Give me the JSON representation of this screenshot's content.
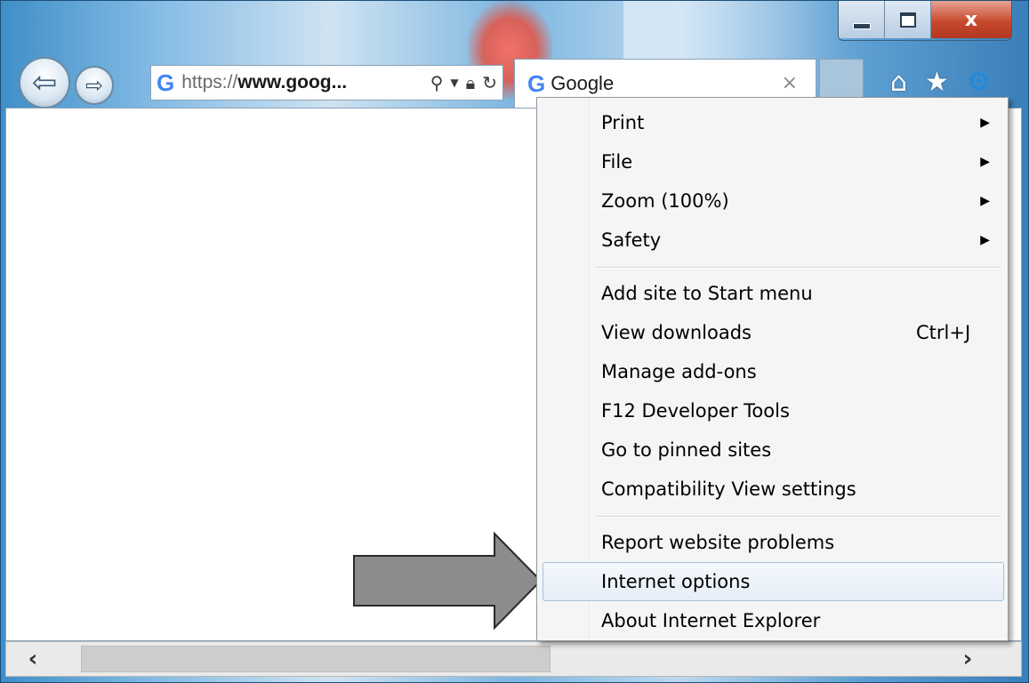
{
  "browser": {
    "address_bar": {
      "url_proto": "https://",
      "url_domain": "www.goog...",
      "icons": [
        "search-icon",
        "dropdown-icon",
        "lock-icon",
        "refresh-icon"
      ]
    },
    "tab": {
      "title": "Google",
      "close": "×"
    },
    "toolbar_icons": [
      "home-icon",
      "favorites-star-icon",
      "tools-gear-icon"
    ],
    "caption": {
      "close": "x"
    }
  },
  "menu": {
    "items": [
      {
        "label": "Print",
        "submenu": true
      },
      {
        "label": "File",
        "submenu": true
      },
      {
        "label": "Zoom (100%)",
        "submenu": true
      },
      {
        "label": "Safety",
        "submenu": true
      },
      {
        "label": "Add site to Start menu"
      },
      {
        "label": "View downloads",
        "shortcut": "Ctrl+J"
      },
      {
        "label": "Manage add-ons"
      },
      {
        "label": "F12 Developer Tools"
      },
      {
        "label": "Go to pinned sites"
      },
      {
        "label": "Compatibility View settings"
      },
      {
        "label": "Report website problems"
      },
      {
        "label": "Internet options",
        "highlighted": true
      },
      {
        "label": "About Internet Explorer"
      }
    ]
  },
  "colors": {
    "accent": "#1d8ae0",
    "close_button": "#c74a2f",
    "highlight_border": "#a5c1dc"
  }
}
